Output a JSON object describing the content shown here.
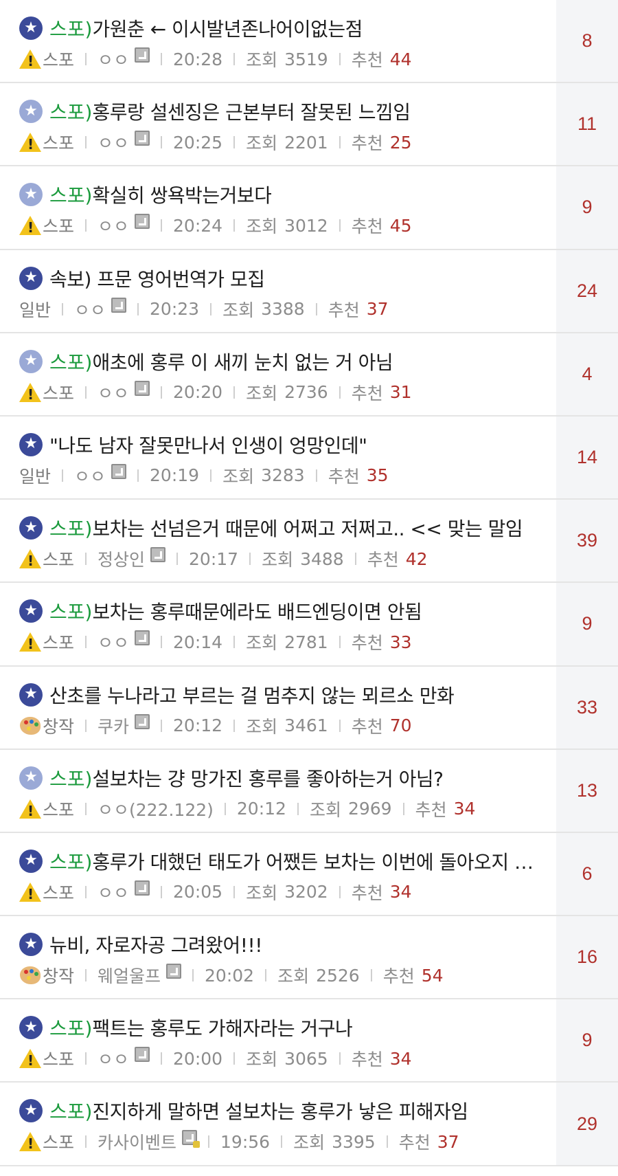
{
  "labels": {
    "views": "조회",
    "recommend": "추천"
  },
  "posts": [
    {
      "star": "dark",
      "prefix": "스포)",
      "title": "가원춘 ← 이시발년존나어이없는점",
      "category": "스포",
      "cat_icon": "warning-icon",
      "author": "ㅇㅇ",
      "badge": true,
      "time": "20:28",
      "views": "3519",
      "recommend": "44",
      "comments": "8"
    },
    {
      "star": "light",
      "prefix": "스포)",
      "title": "홍루랑 설센징은 근본부터 잘못된 느낌임",
      "category": "스포",
      "cat_icon": "warning-icon",
      "author": "ㅇㅇ",
      "badge": true,
      "time": "20:25",
      "views": "2201",
      "recommend": "25",
      "comments": "11"
    },
    {
      "star": "light",
      "prefix": "스포)",
      "title": "확실히 쌍욕박는거보다",
      "category": "스포",
      "cat_icon": "warning-icon",
      "author": "ㅇㅇ",
      "badge": true,
      "time": "20:24",
      "views": "3012",
      "recommend": "45",
      "comments": "9"
    },
    {
      "star": "dark",
      "prefix": "",
      "title": "속보) 프문 영어번역가 모집",
      "category": "일반",
      "cat_icon": "",
      "author": "ㅇㅇ",
      "badge": true,
      "time": "20:23",
      "views": "3388",
      "recommend": "37",
      "comments": "24"
    },
    {
      "star": "light",
      "prefix": "스포)",
      "title": "애초에 홍루 이 새끼 눈치 없는 거 아님",
      "category": "스포",
      "cat_icon": "warning-icon",
      "author": "ㅇㅇ",
      "badge": true,
      "time": "20:20",
      "views": "2736",
      "recommend": "31",
      "comments": "4"
    },
    {
      "star": "dark",
      "prefix": "",
      "title": "\"나도 남자 잘못만나서 인생이 엉망인데\"",
      "category": "일반",
      "cat_icon": "",
      "author": "ㅇㅇ",
      "badge": true,
      "time": "20:19",
      "views": "3283",
      "recommend": "35",
      "comments": "14"
    },
    {
      "star": "dark",
      "prefix": "스포)",
      "title": "보차는 선넘은거 때문에 어쩌고 저쩌고.. << 맞는 말임",
      "category": "스포",
      "cat_icon": "warning-icon",
      "author": "정상인",
      "badge": true,
      "time": "20:17",
      "views": "3488",
      "recommend": "42",
      "comments": "39"
    },
    {
      "star": "dark",
      "prefix": "스포)",
      "title": "보차는 홍루때문에라도 배드엔딩이면 안됨",
      "category": "스포",
      "cat_icon": "warning-icon",
      "author": "ㅇㅇ",
      "badge": true,
      "time": "20:14",
      "views": "2781",
      "recommend": "33",
      "comments": "9"
    },
    {
      "star": "dark",
      "prefix": "",
      "title": "산초를 누나라고 부르는 걸 멈추지 않는 뫼르소 만화",
      "category": "창작",
      "cat_icon": "palette-icon",
      "author": "쿠카",
      "badge": true,
      "time": "20:12",
      "views": "3461",
      "recommend": "70",
      "comments": "33"
    },
    {
      "star": "light",
      "prefix": "스포)",
      "title": "설보차는 걍 망가진 홍루를 좋아하는거 아님?",
      "category": "스포",
      "cat_icon": "warning-icon",
      "author": "ㅇㅇ(222.122)",
      "badge": false,
      "time": "20:12",
      "views": "2969",
      "recommend": "34",
      "comments": "13"
    },
    {
      "star": "dark",
      "prefix": "스포)",
      "title": "홍루가 대했던 태도가 어쨌든 보차는 이번에 돌아오지 …",
      "category": "스포",
      "cat_icon": "warning-icon",
      "author": "ㅇㅇ",
      "badge": true,
      "time": "20:05",
      "views": "3202",
      "recommend": "34",
      "comments": "6"
    },
    {
      "star": "dark",
      "prefix": "",
      "title": "뉴비, 자로자공 그려왔어!!!",
      "category": "창작",
      "cat_icon": "palette-icon",
      "author": "웨얼울프",
      "badge": true,
      "time": "20:02",
      "views": "2526",
      "recommend": "54",
      "comments": "16"
    },
    {
      "star": "dark",
      "prefix": "스포)",
      "title": "팩트는 홍루도 가해자라는 거구나",
      "category": "스포",
      "cat_icon": "warning-icon",
      "author": "ㅇㅇ",
      "badge": true,
      "time": "20:00",
      "views": "3065",
      "recommend": "34",
      "comments": "9"
    },
    {
      "star": "dark",
      "prefix": "스포)",
      "title": "진지하게 말하면 설보차는 홍루가 낳은 피해자임",
      "category": "스포",
      "cat_icon": "warning-icon",
      "author": "카사이벤트",
      "badge": "gold",
      "time": "19:56",
      "views": "3395",
      "recommend": "37",
      "comments": "29"
    }
  ]
}
